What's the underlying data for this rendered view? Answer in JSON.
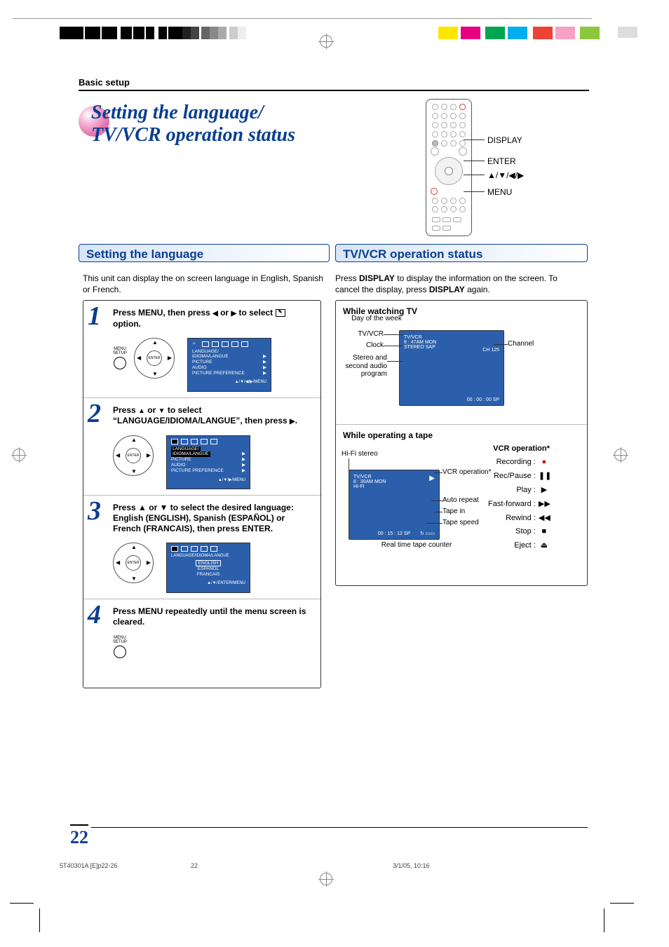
{
  "breadcrumb": "Basic setup",
  "title_line1": "Setting the language/",
  "title_line2": "TV/VCR operation status",
  "remote_labels": {
    "display": "DISPLAY",
    "enter": "ENTER",
    "arrows": "▲/▼/◀/▶",
    "menu": "MENU"
  },
  "sections": {
    "lang_title": "Setting the language",
    "lang_intro": "This unit can display the on screen language in English, Spanish or French.",
    "tvvcr_title": "TV/VCR operation status",
    "tvvcr_intro_1": "Press ",
    "tvvcr_intro_b1": "DISPLAY",
    "tvvcr_intro_2": " to display the information on the screen. To cancel the display, press ",
    "tvvcr_intro_b2": "DISPLAY",
    "tvvcr_intro_3": " again."
  },
  "steps": {
    "s1_num": "1",
    "s1_text_a": "Press MENU, then press ",
    "s1_text_b": " or ",
    "s1_text_c": " to select ",
    "s1_text_d": " option.",
    "s1_btn": "MENU\nSETUP",
    "s1_osd_items": [
      "LANGUAGE/",
      "IDIOMA/LANGUE",
      "PICTURE",
      "AUDIO",
      "PICTURE PREFERENCE"
    ],
    "s1_osd_foot": "▲/▼/◀/▶/MENU",
    "s2_num": "2",
    "s2_text_a": "Press ",
    "s2_text_b": " or ",
    "s2_text_c": " to select “LANGUAGE/IDIOMA/LANGUE”, then press ",
    "s2_text_d": ".",
    "s2_osd_items": [
      "LANGUAGE/",
      "IDIOMA/LANGUE",
      "PICTURE",
      "AUDIO",
      "PICTURE PREFERENCE"
    ],
    "s2_osd_foot": "▲/▼/▶/MENU",
    "s3_num": "3",
    "s3_text": "Press ▲ or ▼ to select the desired language: English (ENGLISH), Spanish (ESPAÑOL) or French (FRANCAIS), then press ENTER.",
    "s3_osd_header": "LANGUAGE/IDIOMA/LANGUE",
    "s3_osd_items": [
      "ENGLISH",
      "ESPAÑOL",
      "FRANCAIS"
    ],
    "s3_osd_foot": "▲/▼/ENTER/MENU",
    "s4_num": "4",
    "s4_text": "Press MENU repeatedly until the menu screen is cleared.",
    "s4_btn": "MENU\nSETUP"
  },
  "display_panel": {
    "title_tv": "While watching TV",
    "title_tape": "While operating a tape",
    "tv_labels": {
      "day": "Day of the week",
      "tvvcr": "TV/VCR",
      "clock": "Clock",
      "stereo": "Stereo and second audio program",
      "channel": "Channel"
    },
    "tv_screen": {
      "l1": "TV/VCR",
      "l2": "8 : 47AM  MON",
      "l3": "STEREO  SAP",
      "ch": "CH   125",
      "counter": "00 : 00 : 00   SP"
    },
    "tape_labels": {
      "hifi": "Hi-Fi stereo",
      "vcrop": "VCR operation*",
      "autorep": "Auto repeat",
      "tapein": "Tape in",
      "tapespeed": "Tape speed",
      "rtcounter": "Real time tape counter"
    },
    "tape_screen": {
      "l1": "TV/VCR",
      "l2": "8 : 30AM  MON",
      "l3": "HI-FI",
      "play": "▶",
      "repeat": "↻",
      "cassette": "▭▭",
      "counter": "00 : 15 : 12   SP"
    },
    "vcr_ops_title": "VCR operation*",
    "vcr_ops": [
      {
        "label": "Recording :",
        "sym": "●",
        "cls": "rec"
      },
      {
        "label": "Rec/Pause :",
        "sym": "❚❚"
      },
      {
        "label": "Play :",
        "sym": "▶"
      },
      {
        "label": "Fast-forward :",
        "sym": "▶▶"
      },
      {
        "label": "Rewind :",
        "sym": "◀◀"
      },
      {
        "label": "Stop :",
        "sym": "■"
      },
      {
        "label": "Eject :",
        "sym": "⏏"
      }
    ]
  },
  "page_number": "22",
  "footer": {
    "file": "5T40301A [E]p22-26",
    "page": "22",
    "date": "3/1/05, 10:16"
  }
}
